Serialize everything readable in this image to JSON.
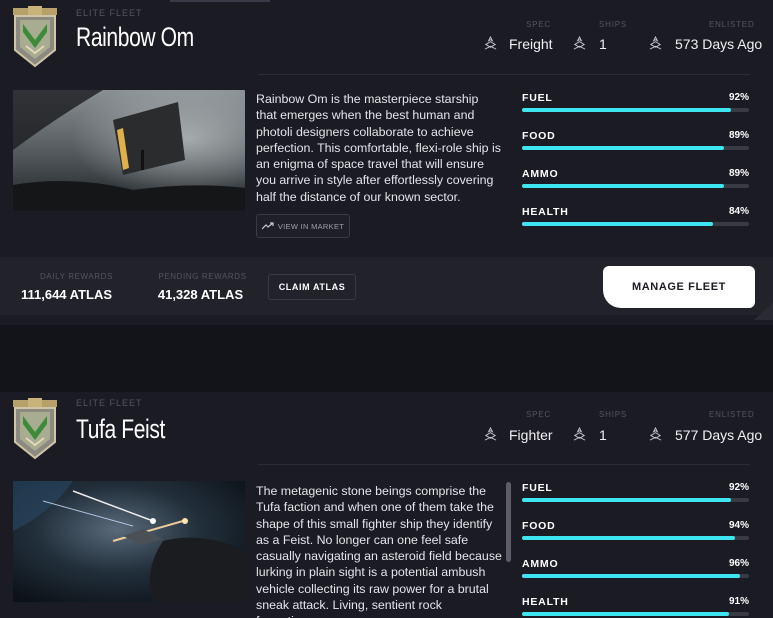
{
  "colors": {
    "accent": "#3ee6f2",
    "card": "#1b1b23",
    "background": "#13131a"
  },
  "fleets": [
    {
      "label": "ELITE FLEET",
      "name": "Rainbow Om",
      "spec_label": "SPEC",
      "spec": "Freight",
      "ships_label": "SHIPS",
      "ships": "1",
      "enlisted_label": "ENLISTED",
      "enlisted": "573 Days Ago",
      "description": "Rainbow Om is the masterpiece starship that emerges when the best human and photoli designers collaborate to achieve perfection. This comfortable, flexi-role ship is an enigma of space travel that will ensure you arrive in style after effortlessly covering half the distance of our known sector.",
      "market_label": "VIEW IN MARKET",
      "stats": [
        {
          "name": "FUEL",
          "pct_label": "92%",
          "value": 0.92
        },
        {
          "name": "FOOD",
          "pct_label": "89%",
          "value": 0.89
        },
        {
          "name": "AMMO",
          "pct_label": "89%",
          "value": 0.89
        },
        {
          "name": "HEALTH",
          "pct_label": "84%",
          "value": 0.84
        }
      ],
      "daily_label": "DAILY REWARDS",
      "daily": "111,644 ATLAS",
      "pending_label": "PENDING REWARDS",
      "pending": "41,328 ATLAS",
      "claim_label": "CLAIM ATLAS",
      "manage_label": "MANAGE FLEET"
    },
    {
      "label": "ELITE FLEET",
      "name": "Tufa Feist",
      "spec_label": "SPEC",
      "spec": "Fighter",
      "ships_label": "SHIPS",
      "ships": "1",
      "enlisted_label": "ENLISTED",
      "enlisted": "577 Days Ago",
      "description": "The metagenic stone beings comprise the Tufa faction and when one of them take the shape of this small fighter ship they identify as a Feist. No longer can one feel safe casually navigating an asteroid field because lurking in plain sight is a potential ambush vehicle collecting its raw power for a brutal sneak attack. Living, sentient rock formations",
      "stats": [
        {
          "name": "FUEL",
          "pct_label": "92%",
          "value": 0.92
        },
        {
          "name": "FOOD",
          "pct_label": "94%",
          "value": 0.94
        },
        {
          "name": "AMMO",
          "pct_label": "96%",
          "value": 0.96
        },
        {
          "name": "HEALTH",
          "pct_label": "91%",
          "value": 0.91
        }
      ]
    }
  ]
}
